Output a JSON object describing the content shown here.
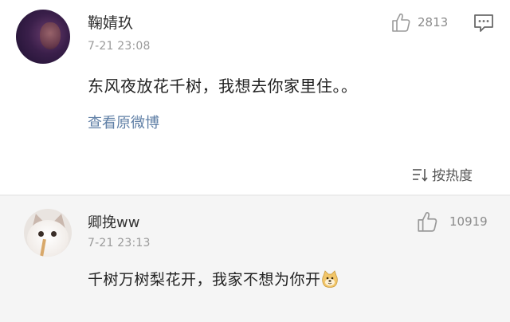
{
  "post": {
    "username": "鞠婧玖",
    "time": "7-21 23:08",
    "like_count": "2813",
    "content": "东风夜放花千树，我想去你家里住。。",
    "view_original": "查看原微博",
    "sort_label": "按热度"
  },
  "reply": {
    "username": "卿挽ww",
    "time": "7-21 23:13",
    "like_count": "10919",
    "content": "千树万树梨花开，我家不想为你开"
  },
  "icons": {
    "like": "thumbs-up-icon",
    "comment": "comment-icon",
    "sort": "sort-icon",
    "emoji": "doge-emoji-icon"
  },
  "colors": {
    "link": "#5f7fa6",
    "reply_bg": "#f5f5f5"
  }
}
